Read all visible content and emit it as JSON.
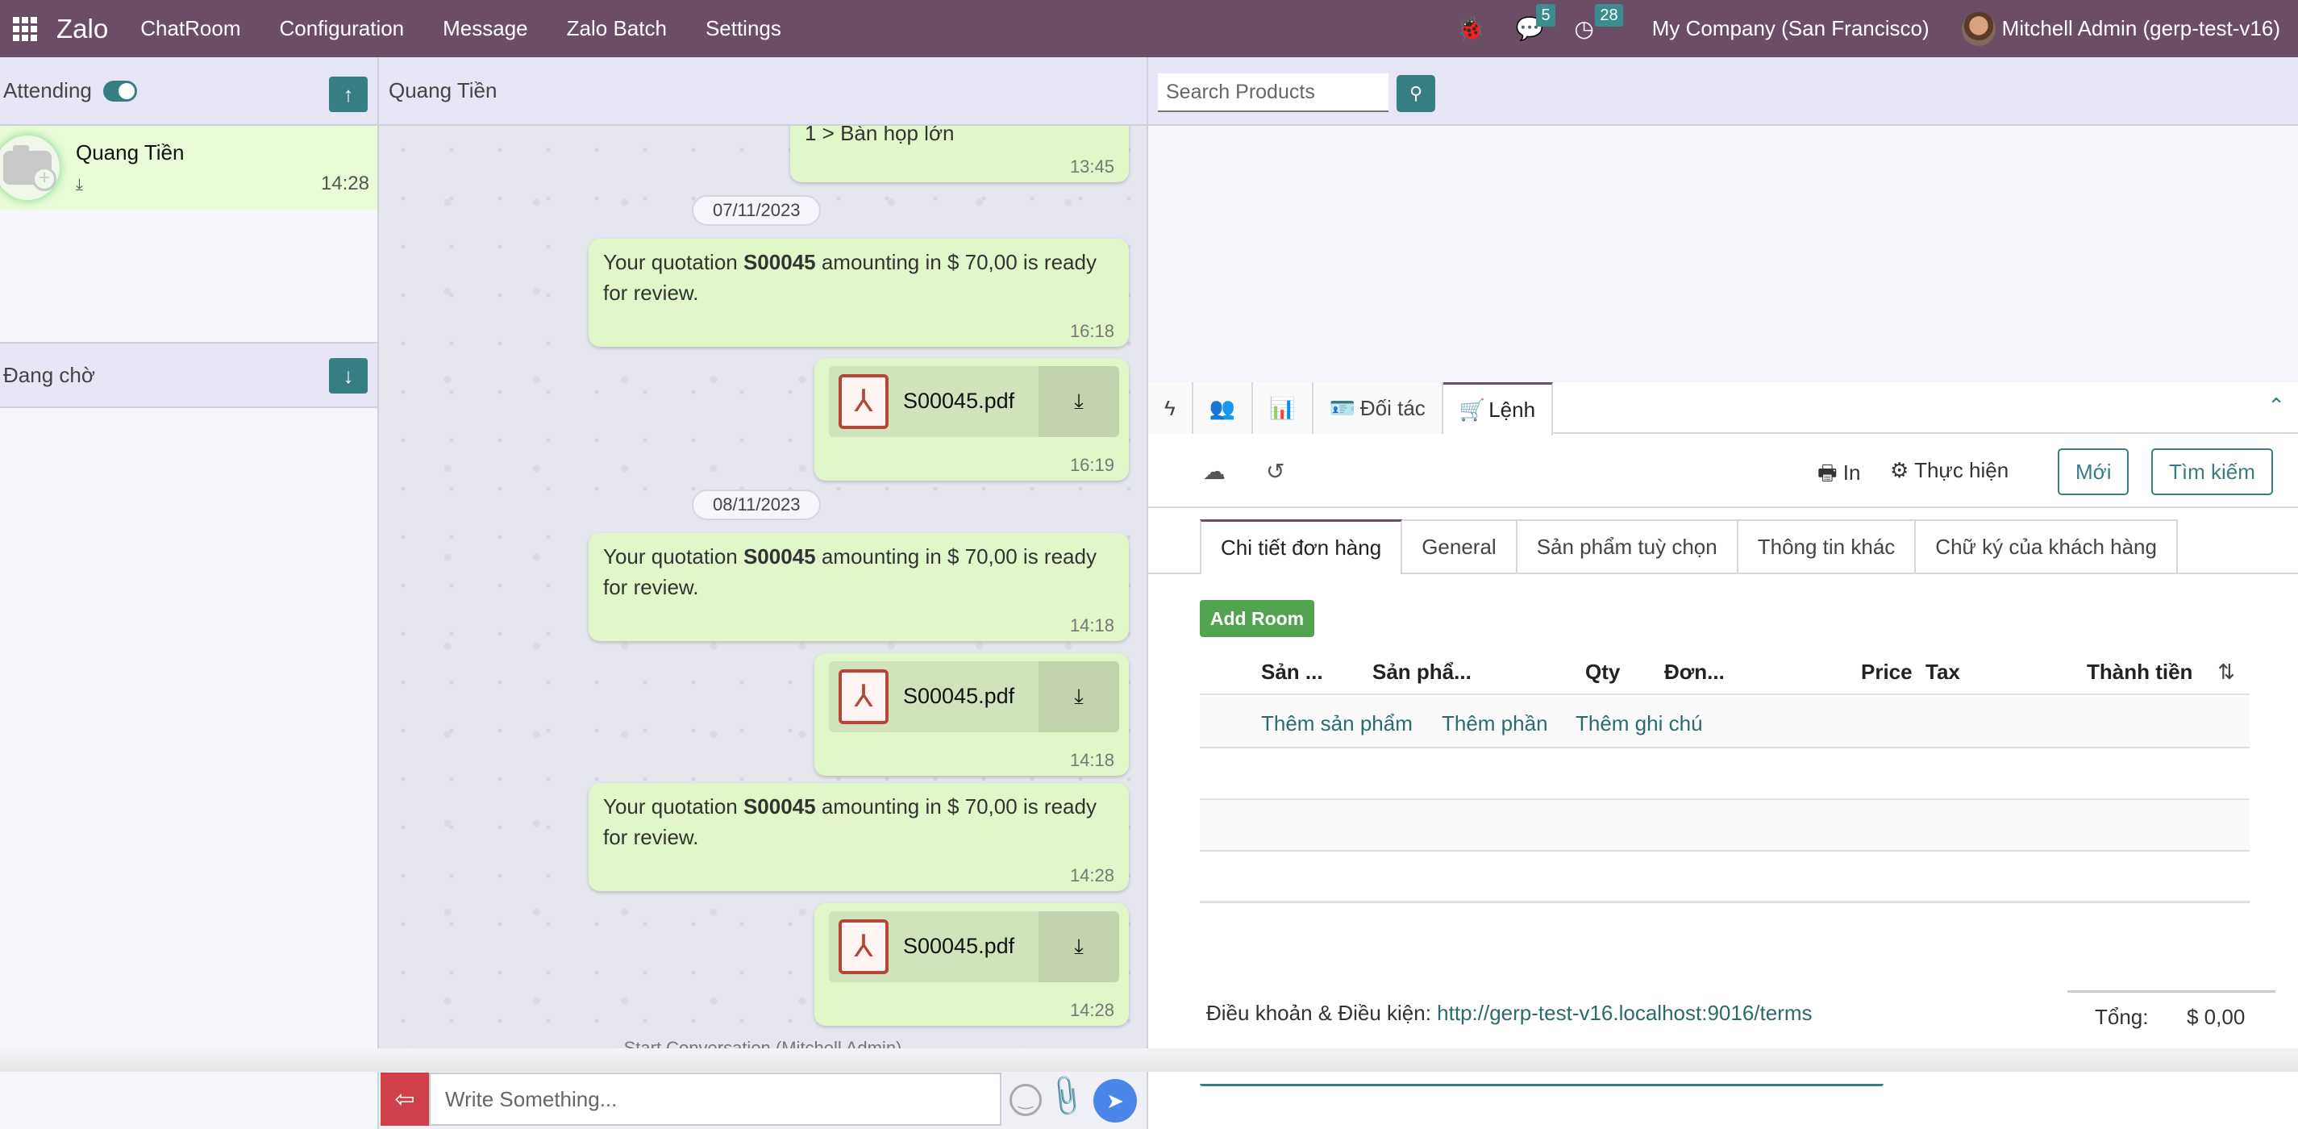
{
  "navbar": {
    "brand": "Zalo",
    "menu": [
      "ChatRoom",
      "Configuration",
      "Message",
      "Zalo Batch",
      "Settings"
    ],
    "messages_badge": "5",
    "activities_badge": "28",
    "company": "My Company (San Francisco)",
    "user": "Mitchell Admin (gerp-test-v16)"
  },
  "left": {
    "attending_label": "Attending",
    "attending_toggle_on": true,
    "contacts": [
      {
        "name": "Quang Tiền",
        "time": "14:28"
      }
    ],
    "waiting_label": "Đang chờ"
  },
  "chat": {
    "contact_name": "Quang Tiền",
    "messages": [
      {
        "type": "text",
        "text_partial": "1 > Bàn họp lớn",
        "time": "13:45"
      },
      {
        "type": "date",
        "date": "07/11/2023"
      },
      {
        "type": "text",
        "prefix": "Your quotation ",
        "bold": "S00045",
        "suffix": " amounting in $ 70,00 is ready for review.",
        "time": "16:18"
      },
      {
        "type": "file",
        "filename": "S00045.pdf",
        "time": "16:19"
      },
      {
        "type": "date",
        "date": "08/11/2023"
      },
      {
        "type": "text",
        "prefix": "Your quotation ",
        "bold": "S00045",
        "suffix": " amounting in $ 70,00 is ready for review.",
        "time": "14:18"
      },
      {
        "type": "file",
        "filename": "S00045.pdf",
        "time": "14:18"
      },
      {
        "type": "text",
        "prefix": "Your quotation ",
        "bold": "S00045",
        "suffix": " amounting in $ 70,00 is ready for review.",
        "time": "14:28"
      },
      {
        "type": "file",
        "filename": "S00045.pdf",
        "time": "14:28"
      }
    ],
    "start_conversation": "Start Conversation (Mitchell Admin)",
    "input_placeholder": "Write Something..."
  },
  "right": {
    "search_placeholder": "Search Products",
    "top_tabs": [
      {
        "icon": "bolt-icon",
        "label": ""
      },
      {
        "icon": "users-icon",
        "label": ""
      },
      {
        "icon": "bar-chart-icon",
        "label": ""
      },
      {
        "icon": "id-card-icon",
        "label": "Đối tác"
      },
      {
        "icon": "cart-icon",
        "label": "Lệnh",
        "active": true
      }
    ],
    "actions": {
      "print": "In",
      "execute": "Thực hiện",
      "new": "Mới",
      "search": "Tìm kiếm"
    },
    "sub_tabs": [
      "Chi tiết đơn hàng",
      "General",
      "Sản phẩm tuỳ chọn",
      "Thông tin khác",
      "Chữ ký của khách hàng"
    ],
    "add_room": "Add Room",
    "columns": [
      "Sản ...",
      "Sản phẩ...",
      "Qty",
      "Đơn...",
      "Price",
      "Tax",
      "Thành tiền"
    ],
    "add_links": [
      "Thêm sản phẩm",
      "Thêm phần",
      "Thêm ghi chú"
    ],
    "terms_label": "Điều khoản & Điều kiện: ",
    "terms_link": "http://gerp-test-v16.localhost:9016/terms",
    "total_label": "Tổng:",
    "total_value": "$ 0,00"
  }
}
